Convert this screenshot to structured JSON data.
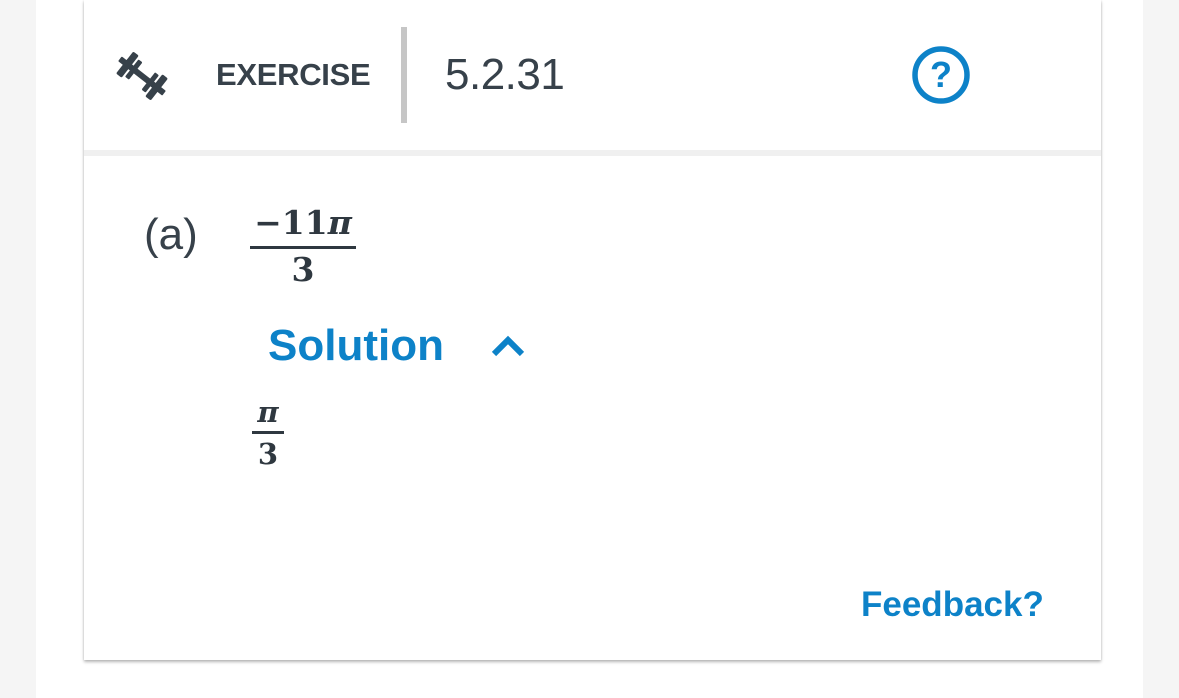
{
  "header": {
    "section_label": "EXERCISE",
    "exercise_number": "5.2.31",
    "icon": "dumbbell-icon",
    "help_icon": "help-icon",
    "help_symbol": "?"
  },
  "problem": {
    "part_label": "(a)",
    "question": {
      "numerator_prefix": "−11",
      "numerator_symbol": "π",
      "denominator": "3"
    },
    "solution": {
      "toggle_label": "Solution",
      "toggle_icon": "chevron-up-icon",
      "expanded": true,
      "answer": {
        "numerator_symbol": "π",
        "denominator": "3"
      }
    }
  },
  "footer": {
    "feedback_label": "Feedback?"
  },
  "colors": {
    "accent": "#0d82c8",
    "text": "#37414a",
    "divider": "#c6c6c6"
  }
}
